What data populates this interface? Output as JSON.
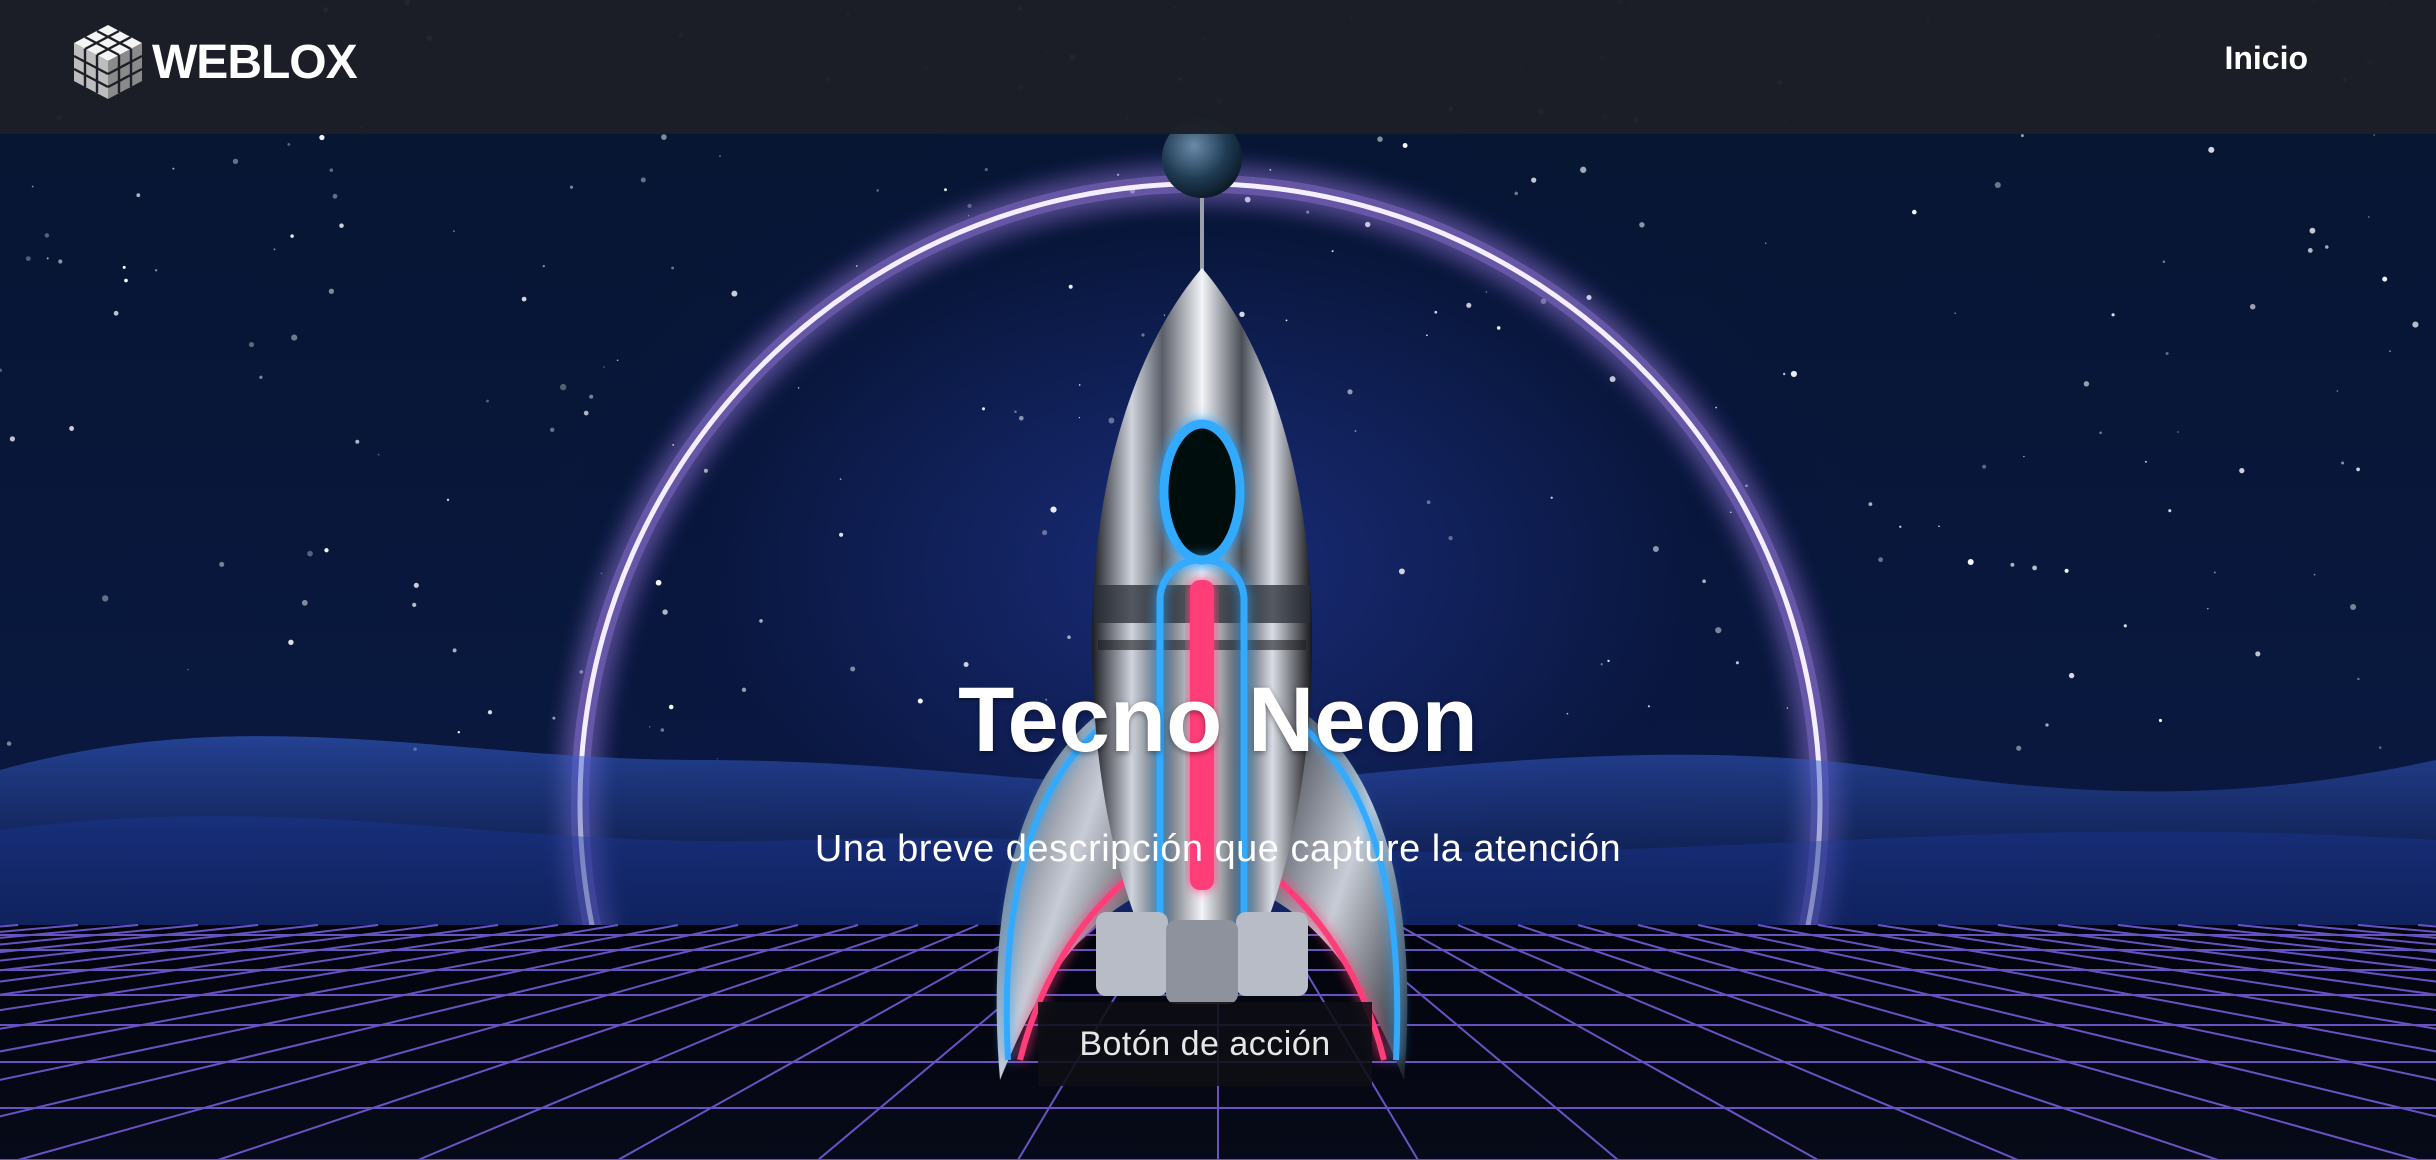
{
  "navbar": {
    "brand": "WEBLOX",
    "links": [
      {
        "label": "Inicio"
      }
    ]
  },
  "hero": {
    "title": "Tecno Neon",
    "subtitle": "Una breve descripción que capture la atención",
    "cta_label": "Botón de acción",
    "background_image_alt": "neon-rocket-space-scene"
  },
  "colors": {
    "navbar_bg": "#1c1f26",
    "neon_ring": "#b48cff",
    "neon_cyan": "#33aaff",
    "neon_pink": "#ff3c78",
    "grid_line": "#8a6cff",
    "text": "#ffffff"
  }
}
